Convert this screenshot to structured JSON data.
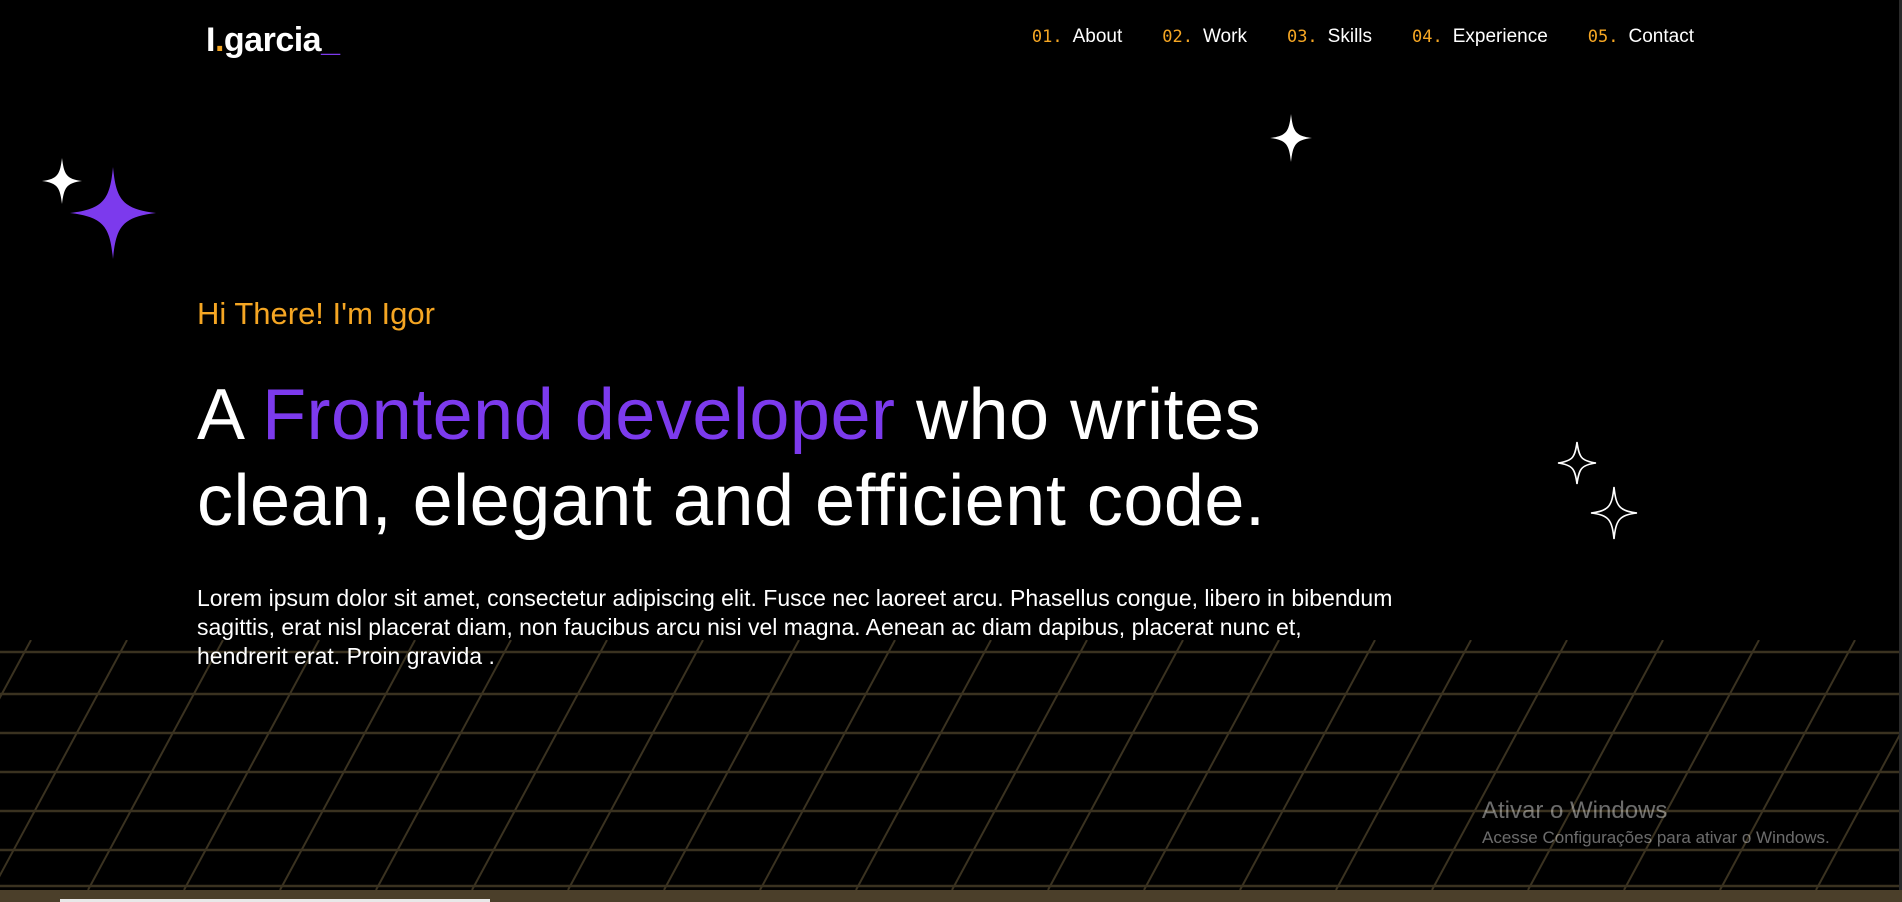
{
  "logo": {
    "letter": "I",
    "dot": ".",
    "name": "garcia",
    "cursor": "_"
  },
  "nav": [
    {
      "num": "01.",
      "label": "About"
    },
    {
      "num": "02.",
      "label": "Work"
    },
    {
      "num": "03.",
      "label": "Skills"
    },
    {
      "num": "04.",
      "label": "Experience"
    },
    {
      "num": "05.",
      "label": "Contact"
    }
  ],
  "hero": {
    "greeting": "Hi There! I'm Igor",
    "headline_pre": "A ",
    "headline_accent": "Frontend developer",
    "headline_post": " who writes clean, elegant and efficient code.",
    "lead": "Lorem ipsum dolor sit amet, consectetur adipiscing elit. Fusce nec laoreet arcu. Phasellus congue, libero in bibendum sagittis, erat nisl placerat diam, non faucibus arcu nisi vel magna. Aenean ac diam dapibus, placerat nunc et, hendrerit erat. Proin gravida ."
  },
  "watermark": {
    "title": "Ativar o Windows",
    "subtitle": "Acesse Configurações para ativar o Windows."
  },
  "colors": {
    "background": "#000000",
    "accent_orange": "#f5a623",
    "accent_purple": "#7c3aed",
    "text": "#ffffff",
    "grid": "#3a3220"
  },
  "icons": [
    "sparkle-white-small-icon",
    "sparkle-purple-large-icon",
    "sparkle-white-icon",
    "sparkle-outline-icon"
  ]
}
